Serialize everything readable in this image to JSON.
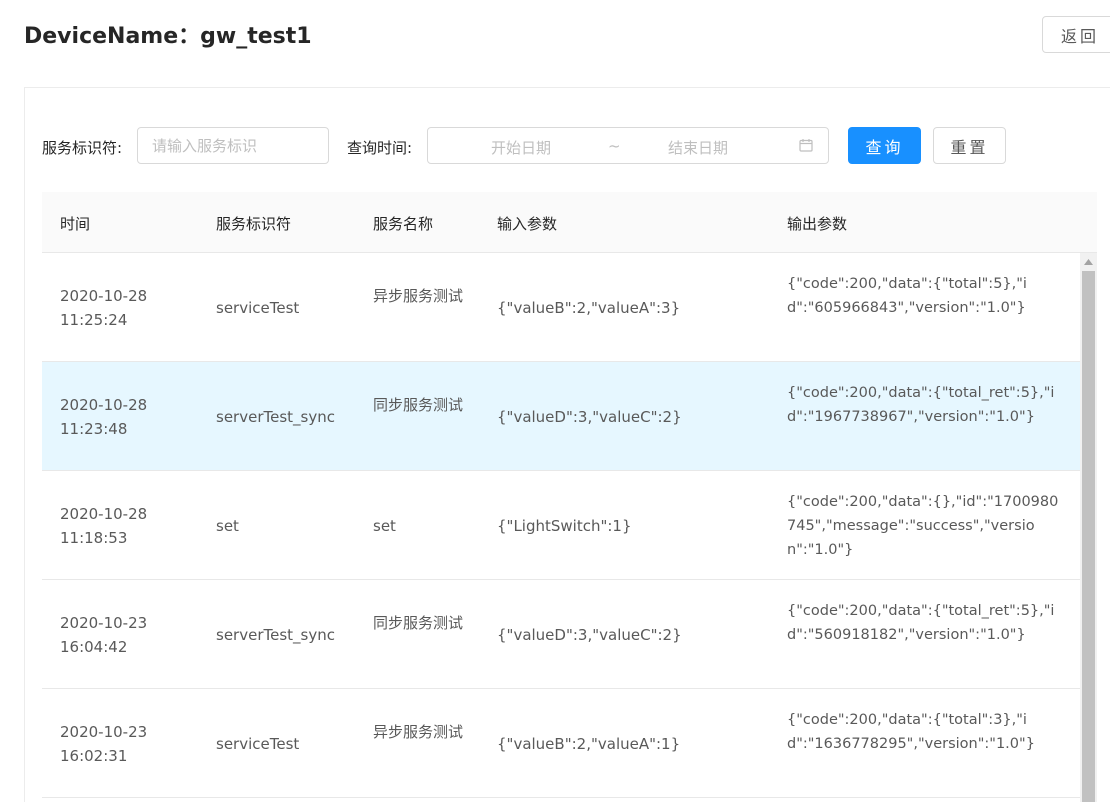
{
  "header": {
    "title": "DeviceName：gw_test1",
    "back_label": "返回"
  },
  "filters": {
    "service_id_label": "服务标识符:",
    "service_id_placeholder": "请输入服务标识",
    "time_label": "查询时间:",
    "start_placeholder": "开始日期",
    "range_separator": "~",
    "end_placeholder": "结束日期",
    "query_label": "查询",
    "reset_label": "重置"
  },
  "table": {
    "columns": [
      "时间",
      "服务标识符",
      "服务名称",
      "输入参数",
      "输出参数"
    ],
    "rows": [
      {
        "time_date": "2020-10-28",
        "time_clock": "11:25:24",
        "service_id": "serviceTest",
        "service_name": "异步服务测试",
        "input": "{\"valueB\":2,\"valueA\":3}",
        "output": "{\"code\":200,\"data\":{\"total\":5},\"id\":\"605966843\",\"version\":\"1.0\"}"
      },
      {
        "time_date": "2020-10-28",
        "time_clock": "11:23:48",
        "service_id": "serverTest_sync",
        "service_name": "同步服务测试",
        "input": "{\"valueD\":3,\"valueC\":2}",
        "output": "{\"code\":200,\"data\":{\"total_ret\":5},\"id\":\"1967738967\",\"version\":\"1.0\"}"
      },
      {
        "time_date": "2020-10-28",
        "time_clock": "11:18:53",
        "service_id": "set",
        "service_name": "set",
        "input": "{\"LightSwitch\":1}",
        "output": "{\"code\":200,\"data\":{},\"id\":\"1700980745\",\"message\":\"success\",\"version\":\"1.0\"}"
      },
      {
        "time_date": "2020-10-23",
        "time_clock": "16:04:42",
        "service_id": "serverTest_sync",
        "service_name": "同步服务测试",
        "input": "{\"valueD\":3,\"valueC\":2}",
        "output": "{\"code\":200,\"data\":{\"total_ret\":5},\"id\":\"560918182\",\"version\":\"1.0\"}"
      },
      {
        "time_date": "2020-10-23",
        "time_clock": "16:02:31",
        "service_id": "serviceTest",
        "service_name": "异步服务测试",
        "input": "{\"valueB\":2,\"valueA\":1}",
        "output": "{\"code\":200,\"data\":{\"total\":3},\"id\":\"1636778295\",\"version\":\"1.0\"}"
      }
    ]
  },
  "colors": {
    "primary": "#1890ff",
    "selected_row": "#e6f7ff",
    "header_bg": "#fafafa"
  },
  "icons": {
    "date_picker": "calendar-icon",
    "scroll_up": "scroll-up-arrow-icon"
  }
}
